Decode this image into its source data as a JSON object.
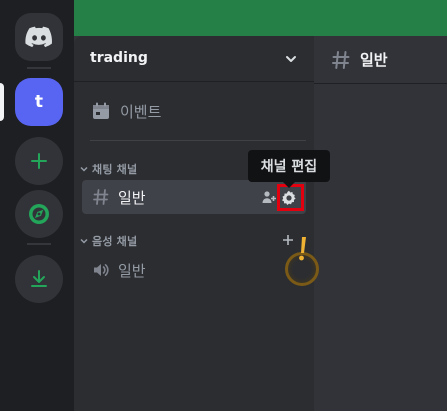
{
  "server_rail": {
    "home_icon": "discord-logo-icon",
    "server_initial": "t",
    "add_icon": "plus-icon",
    "explore_icon": "compass-icon",
    "download_icon": "download-icon"
  },
  "sidebar": {
    "server_name": "trading",
    "events_label": "이벤트",
    "categories": [
      {
        "label": "채팅 채널",
        "channels": [
          {
            "label": "일반",
            "type": "text"
          }
        ]
      },
      {
        "label": "음성 채널",
        "channels": [
          {
            "label": "일반",
            "type": "voice"
          }
        ]
      }
    ]
  },
  "tooltip": {
    "text": "채널 편집"
  },
  "main": {
    "channel_name": "일반"
  },
  "colors": {
    "green_banner": "#248046",
    "blurple": "#5865f2",
    "green_icon": "#23a55a",
    "highlight_red": "#e3000f",
    "click_yellow": "#f0b232"
  }
}
